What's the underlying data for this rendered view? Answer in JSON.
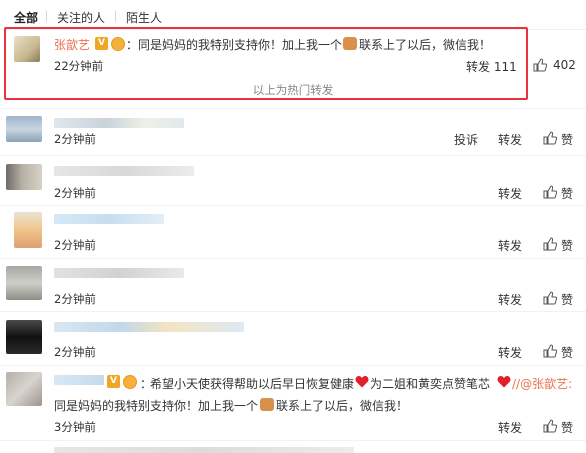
{
  "tabs": [
    "全部",
    "关注的人",
    "陌生人"
  ],
  "featured": {
    "name": "张歆艺",
    "badge": "V",
    "text_a": "：同是妈妈的我特别支持你！加上我一个",
    "text_b": "联系上了以后，微信我！",
    "time": "22分钟前",
    "forward": "转发 111",
    "likes": "402",
    "hot_note": "以上为热门转发"
  },
  "rows": [
    {
      "time": "2分钟前",
      "report": "投诉",
      "forward": "转发",
      "like": "赞"
    },
    {
      "time": "2分钟前",
      "forward": "转发",
      "like": "赞"
    },
    {
      "time": "2分钟前",
      "forward": "转发",
      "like": "赞"
    },
    {
      "time": "2分钟前",
      "forward": "转发",
      "like": "赞"
    },
    {
      "time": "2分钟前",
      "forward": "转发",
      "like": "赞"
    }
  ],
  "last": {
    "line1": "希望小天使获得帮助以后早日恢复健康",
    "line1b": "为二姐和黄奕点赞笔芯",
    "mention": "//@张歆艺:",
    "line2a": "同是妈妈的我特别支持你！加上我一个",
    "line2b": "联系上了以后，微信我！",
    "time": "3分钟前",
    "forward": "转发",
    "like": "赞"
  },
  "colors": {
    "highlight": "#e8323c",
    "link": "#eb7350",
    "badge": "#f0a523",
    "heart": "#e0202a"
  }
}
